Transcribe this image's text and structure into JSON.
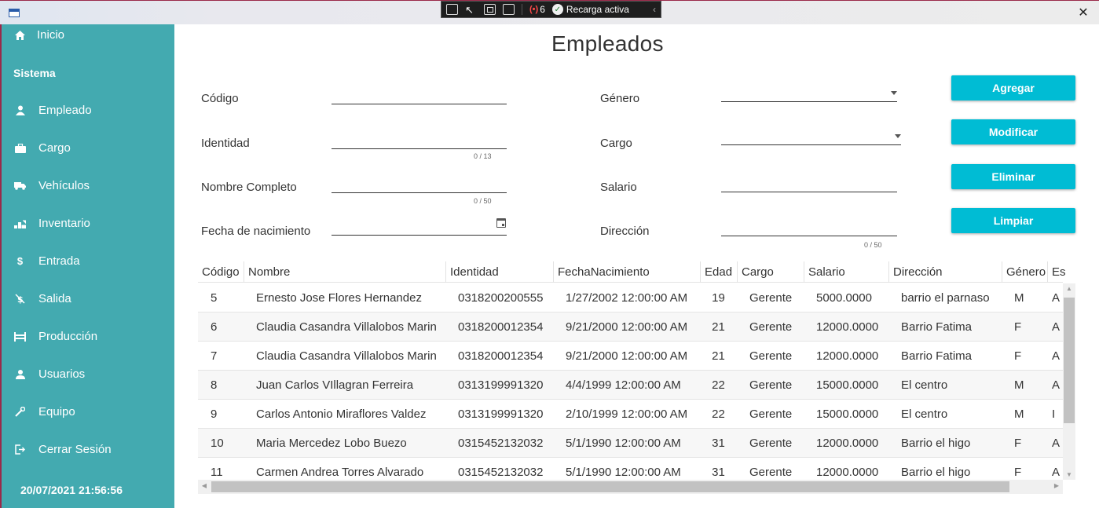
{
  "window": {
    "close_glyph": "✕"
  },
  "debug_toolbar": {
    "error_count": "6",
    "reload_label": "Recarga activa"
  },
  "sidebar": {
    "home_label": "Inicio",
    "section_title": "Sistema",
    "items": [
      {
        "label": "Empleado",
        "icon": "employee-icon"
      },
      {
        "label": "Cargo",
        "icon": "briefcase-icon"
      },
      {
        "label": "Vehículos",
        "icon": "truck-icon"
      },
      {
        "label": "Inventario",
        "icon": "inventory-icon"
      },
      {
        "label": "Entrada",
        "icon": "dollar-icon"
      },
      {
        "label": "Salida",
        "icon": "money-off-icon"
      },
      {
        "label": "Producción",
        "icon": "production-icon"
      },
      {
        "label": "Usuarios",
        "icon": "user-icon"
      },
      {
        "label": "Equipo",
        "icon": "wrench-icon"
      },
      {
        "label": "Cerrar Sesión",
        "icon": "logout-icon"
      }
    ],
    "datetime": "20/07/2021 21:56:56"
  },
  "page": {
    "title": "Empleados"
  },
  "form": {
    "codigo_label": "Código",
    "identidad_label": "Identidad",
    "identidad_counter": "0 / 13",
    "nombre_label": "Nombre Completo",
    "nombre_counter": "0 / 50",
    "fecha_label": "Fecha de nacimiento",
    "genero_label": "Género",
    "cargo_label": "Cargo",
    "salario_label": "Salario",
    "direccion_label": "Dirección",
    "direccion_counter": "0 / 50"
  },
  "buttons": {
    "agregar": "Agregar",
    "modificar": "Modificar",
    "eliminar": "Eliminar",
    "limpiar": "Limpiar"
  },
  "table": {
    "columns": [
      "Código",
      "Nombre",
      "Identidad",
      "FechaNacimiento",
      "Edad",
      "Cargo",
      "Salario",
      "Dirección",
      "Género",
      "Es"
    ],
    "rows": [
      [
        "5",
        "Ernesto Jose  Flores Hernandez",
        "0318200200555",
        "1/27/2002 12:00:00 AM",
        "19",
        "Gerente",
        "5000.0000",
        "barrio el parnaso",
        "M",
        "A"
      ],
      [
        "6",
        "Claudia Casandra Villalobos Marin",
        "0318200012354",
        "9/21/2000 12:00:00 AM",
        "21",
        "Gerente",
        "12000.0000",
        "Barrio Fatima",
        "F",
        "A"
      ],
      [
        "7",
        "Claudia Casandra Villalobos Marin",
        "0318200012354",
        "9/21/2000 12:00:00 AM",
        "21",
        "Gerente",
        "12000.0000",
        "Barrio Fatima",
        "F",
        "A"
      ],
      [
        "8",
        "Juan Carlos VIllagran Ferreira",
        "0313199991320",
        "4/4/1999 12:00:00 AM",
        "22",
        "Gerente",
        "15000.0000",
        "El centro",
        "M",
        "A"
      ],
      [
        "9",
        "Carlos Antonio Miraflores Valdez",
        "0313199991320",
        "2/10/1999 12:00:00 AM",
        "22",
        "Gerente",
        "15000.0000",
        "El centro",
        "M",
        "I"
      ],
      [
        "10",
        "Maria Mercedez Lobo Buezo",
        "0315452132032",
        "5/1/1990 12:00:00 AM",
        "31",
        "Gerente",
        "12000.0000",
        "Barrio el higo",
        "F",
        "A"
      ],
      [
        "11",
        "Carmen Andrea Torres Alvarado",
        "0315452132032",
        "5/1/1990 12:00:00 AM",
        "31",
        "Gerente",
        "12000.0000",
        "Barrio el higo",
        "F",
        "A"
      ]
    ]
  }
}
